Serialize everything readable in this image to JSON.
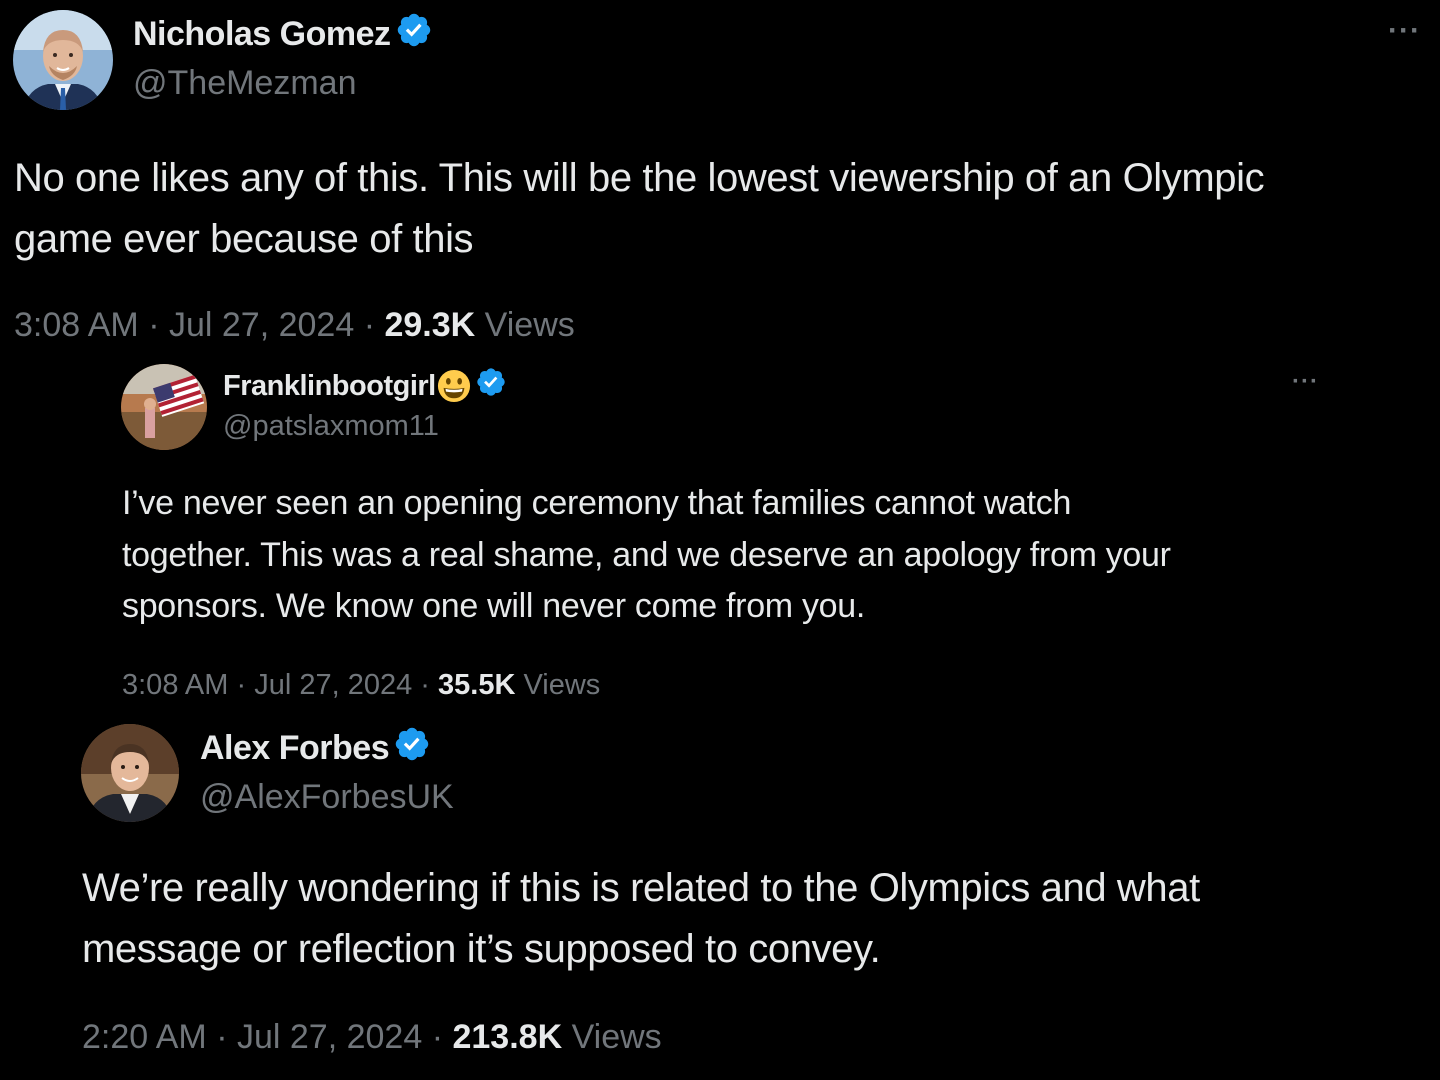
{
  "colors": {
    "background": "#000000",
    "text_primary": "#e7e9ea",
    "text_secondary": "#71767b",
    "verified_badge": "#1d9bf0"
  },
  "tweets": [
    {
      "display_name": "Nicholas Gomez",
      "handle": "@TheMezman",
      "verified_icon": "verified-badge-icon",
      "more_icon": "more-options-icon",
      "more_label": "···",
      "text_lines": [
        "No one likes any of this. This will be the lowest viewership of an Olympic",
        "game ever because of this"
      ],
      "time": "3:08 AM",
      "date": "Jul 27, 2024",
      "views_count": "29.3K",
      "views_label": "Views",
      "separator": "·"
    },
    {
      "display_name": "Franklinbootgirl",
      "name_emoji": "grinning-face-emoji",
      "handle": "@patslaxmom11",
      "verified_icon": "verified-badge-icon",
      "more_icon": "more-options-icon",
      "more_label": "···",
      "text_lines": [
        "I’ve never seen an opening ceremony that families cannot watch",
        "together. This was a real shame, and we deserve an apology from your",
        "sponsors. We know one will never come from you."
      ],
      "time": "3:08 AM",
      "date": "Jul 27, 2024",
      "views_count": "35.5K",
      "views_label": "Views",
      "separator": "·"
    },
    {
      "display_name": "Alex Forbes",
      "handle": "@AlexForbesUK",
      "verified_icon": "verified-badge-icon",
      "text_lines": [
        "We’re really wondering if this is related to the Olympics and what",
        "message or reflection it’s supposed to convey."
      ],
      "time": "2:20 AM",
      "date": "Jul 27, 2024",
      "views_count": "213.8K",
      "views_label": "Views",
      "separator": "·"
    }
  ]
}
